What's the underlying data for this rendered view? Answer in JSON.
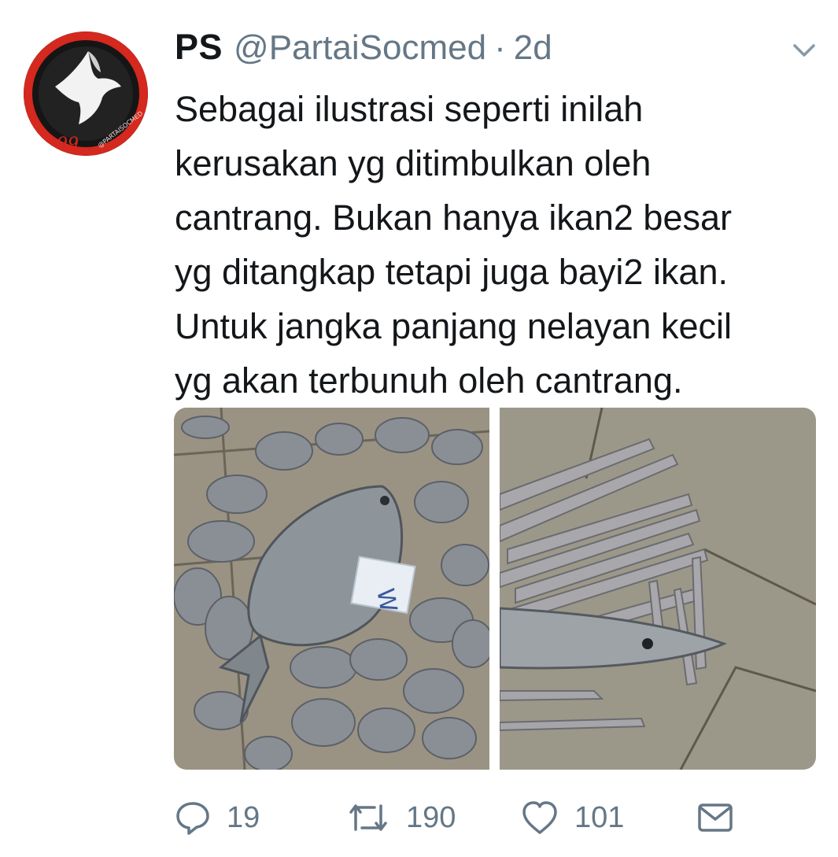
{
  "tweet": {
    "display_name": "PS",
    "handle": "@PartaiSocmed",
    "separator": "·",
    "time": "2d",
    "avatar": {
      "watermark": "@PARTAISOCMED",
      "accent_color": "#d5281e"
    },
    "text": "Sebagai ilustrasi seperti inilah\nkerusakan yg ditimbulkan oleh\ncantrang. Bukan hanya ikan2 besar\nyg ditangkap tetapi juga bayi2 ikan.\nUntuk jangka panjang nelayan kecil\nyg akan terbunuh oleh cantrang.",
    "media": [
      {
        "subject": "pomfret-catch-photo",
        "label": "W"
      },
      {
        "subject": "barracuda-catch-photo"
      }
    ],
    "actions": {
      "reply_count": "19",
      "retweet_count": "190",
      "like_count": "101"
    }
  },
  "icons": [
    "chevron-down-icon",
    "reply-icon",
    "retweet-icon",
    "heart-icon",
    "envelope-icon"
  ],
  "colors": {
    "text_primary": "#14171a",
    "text_secondary": "#657786",
    "icon": "#657786"
  }
}
